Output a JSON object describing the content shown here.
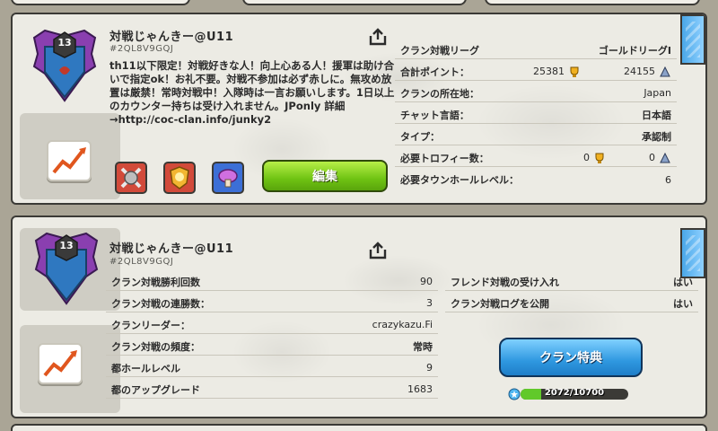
{
  "clan1": {
    "level": "13",
    "name": "対戦じゃんきー@U11",
    "tag": "#2QL8V9GQJ",
    "description": "th11以下限定！対戦好きな人！向上心ある人！援軍は助け合いで指定ok！お礼不要。対戦不参加は必ず赤しに。無攻め放置は厳禁！常時対戦中！入隊時は一言お願いします。1日以上のカウンター持ちは受け入れません。JPonly 詳細→http://coc-clan.info/junky2",
    "edit_label": "編集",
    "share_icon": "share-icon",
    "info": [
      {
        "label": "クラン対戦リーグ",
        "value": "ゴールドリーグI"
      },
      {
        "label": "合計ポイント：",
        "value": "25381",
        "value2": "24155"
      },
      {
        "label": "クランの所在地：",
        "value": "Japan"
      },
      {
        "label": "チャット言語：",
        "value": "日本語"
      },
      {
        "label": "タイプ：",
        "value": "承認制"
      },
      {
        "label": "必要トロフィー数：",
        "value": "0",
        "value2": "0"
      },
      {
        "label": "必要タウンホールレベル：",
        "value": "6"
      }
    ]
  },
  "clan2": {
    "level": "13",
    "name": "対戦じゃんきー@U11",
    "tag": "#2QL8V9GQJ",
    "stats_left": [
      {
        "label": "クラン対戦勝利回数",
        "value": "90"
      },
      {
        "label": "クラン対戦の連勝数：",
        "value": "3"
      },
      {
        "label": "クランリーダー：",
        "value": "crazykazu.Fi"
      },
      {
        "label": "クラン対戦の頻度：",
        "value": "常時"
      },
      {
        "label": "都ホールレベル",
        "value": "9"
      },
      {
        "label": "都のアップグレード",
        "value": "1683"
      }
    ],
    "stats_right": [
      {
        "label": "フレンド対戦の受け入れ",
        "value": "はい"
      },
      {
        "label": "クラン対戦ログを公開",
        "value": "はい"
      }
    ],
    "perks_label": "クラン特典",
    "xp_text": "2072/10700",
    "xp_fraction": 0.194
  },
  "colors": {
    "badge_purple": "#8a3fb0",
    "badge_blue": "#2f78c0",
    "green_button": "#6fc313",
    "blue_button": "#2f98e0",
    "ribbon": "#4aa7e8"
  }
}
